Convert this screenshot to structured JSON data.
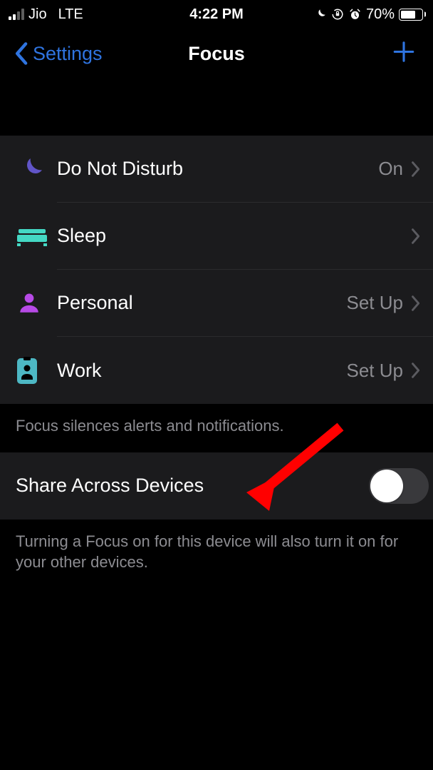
{
  "statusBar": {
    "carrier": "Jio",
    "network": "LTE",
    "time": "4:22 PM",
    "batteryPct": "70%"
  },
  "nav": {
    "back": "Settings",
    "title": "Focus"
  },
  "focusModes": [
    {
      "label": "Do Not Disturb",
      "status": "On",
      "iconColor": "#6155c8",
      "icon": "moon"
    },
    {
      "label": "Sleep",
      "status": "",
      "iconColor": "#44d8c4",
      "icon": "bed"
    },
    {
      "label": "Personal",
      "status": "Set Up",
      "iconColor": "#b74ae6",
      "icon": "person"
    },
    {
      "label": "Work",
      "status": "Set Up",
      "iconColor": "#4db8c4",
      "icon": "badge"
    }
  ],
  "footer1": "Focus silences alerts and notifications.",
  "share": {
    "label": "Share Across Devices",
    "on": false
  },
  "footer2": "Turning a Focus on for this device will also turn it on for your other devices."
}
